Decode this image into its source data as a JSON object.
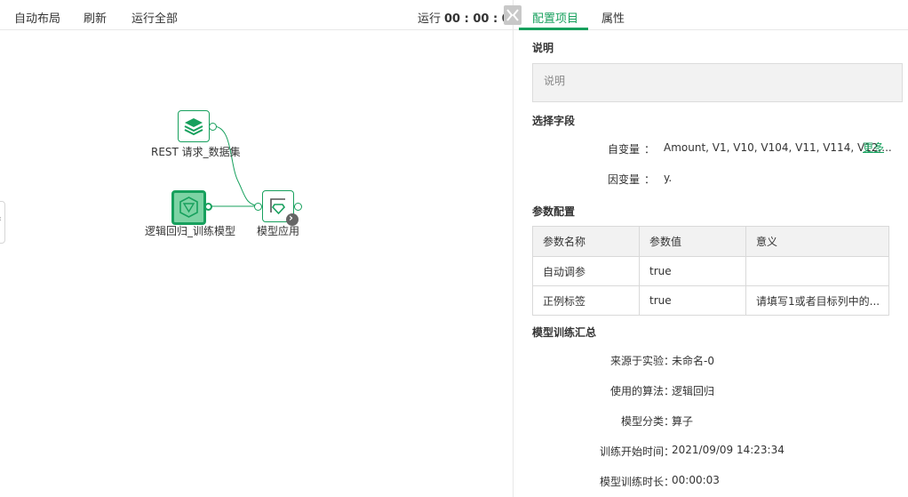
{
  "toolbar": {
    "auto_layout": "自动布局",
    "refresh": "刷新",
    "run_all": "运行全部",
    "run_label": "运行",
    "run_time": "00 : 00 : 00"
  },
  "canvas": {
    "nodes": [
      {
        "label": "REST 请求_数据集",
        "icon": "layers-icon"
      },
      {
        "label": "逻辑回归_训练模型",
        "icon": "model-cube-icon",
        "selected": true
      },
      {
        "label": "模型应用",
        "icon": "model-apply-icon"
      }
    ]
  },
  "tabs": [
    {
      "label": "配置项目",
      "active": true
    },
    {
      "label": "属性",
      "active": false
    }
  ],
  "description": {
    "title": "说明",
    "placeholder": "说明"
  },
  "fields": {
    "title": "选择字段",
    "independent_label": "自变量",
    "independent_value": "Amount, V1, V10, V104, V11, V114, V12,...",
    "more": "更多",
    "dependent_label": "因变量",
    "dependent_value": "y."
  },
  "separator": "：",
  "params": {
    "title": "参数配置",
    "headers": [
      "参数名称",
      "参数值",
      "意义"
    ],
    "rows": [
      [
        "自动调参",
        "true",
        ""
      ],
      [
        "正例标签",
        "true",
        "请填写1或者目标列中的..."
      ]
    ]
  },
  "summary": {
    "title": "模型训练汇总",
    "rows": [
      {
        "label": "来源于实验",
        "value": "未命名-0"
      },
      {
        "label": "使用的算法",
        "value": "逻辑回归"
      },
      {
        "label": "模型分类",
        "value": "算子"
      },
      {
        "label": "训练开始时间",
        "value": "2021/09/09 14:23:34"
      },
      {
        "label": "模型训练时长",
        "value": "00:00:03"
      }
    ]
  },
  "colors": {
    "accent": "#17a05d",
    "selected_node_fill": "#7dd3a4"
  }
}
